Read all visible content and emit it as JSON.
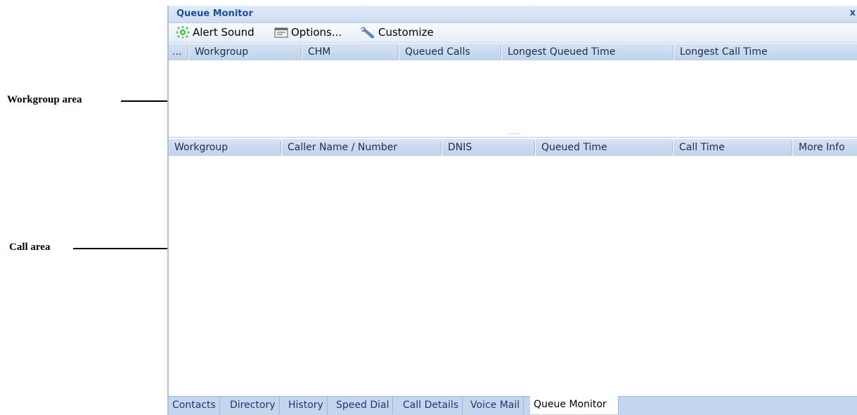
{
  "annotations": {
    "workgroup_area": "Workgroup area",
    "call_area": "Call area"
  },
  "window": {
    "title": "Queue Monitor",
    "close_label": "x"
  },
  "toolbar": {
    "alert_sound": "Alert Sound",
    "options": "Options...",
    "customize": "Customize"
  },
  "workgroup_grid": {
    "columns": [
      "...",
      "Workgroup",
      "CHM",
      "Queued Calls",
      "Longest Queued Time",
      "Longest Call Time"
    ]
  },
  "splitter": {
    "grip": "....."
  },
  "call_grid": {
    "columns": [
      "Workgroup",
      "Caller Name / Number",
      "DNIS",
      "Queued Time",
      "Call Time",
      "More Info"
    ]
  },
  "tabs": [
    "Contacts",
    "Directory",
    "History",
    "Speed Dial",
    "Call Details",
    "Voice Mail",
    "Queue Monitor"
  ],
  "active_tab": "Queue Monitor",
  "colors": {
    "title": "#1f4e9c",
    "header_bg": "#bfd3ec",
    "tab_bar": "#c4d6ee"
  },
  "icons": {
    "alert_sound": "alert-sound-icon",
    "options": "options-icon",
    "customize": "customize-wrench-icon"
  }
}
